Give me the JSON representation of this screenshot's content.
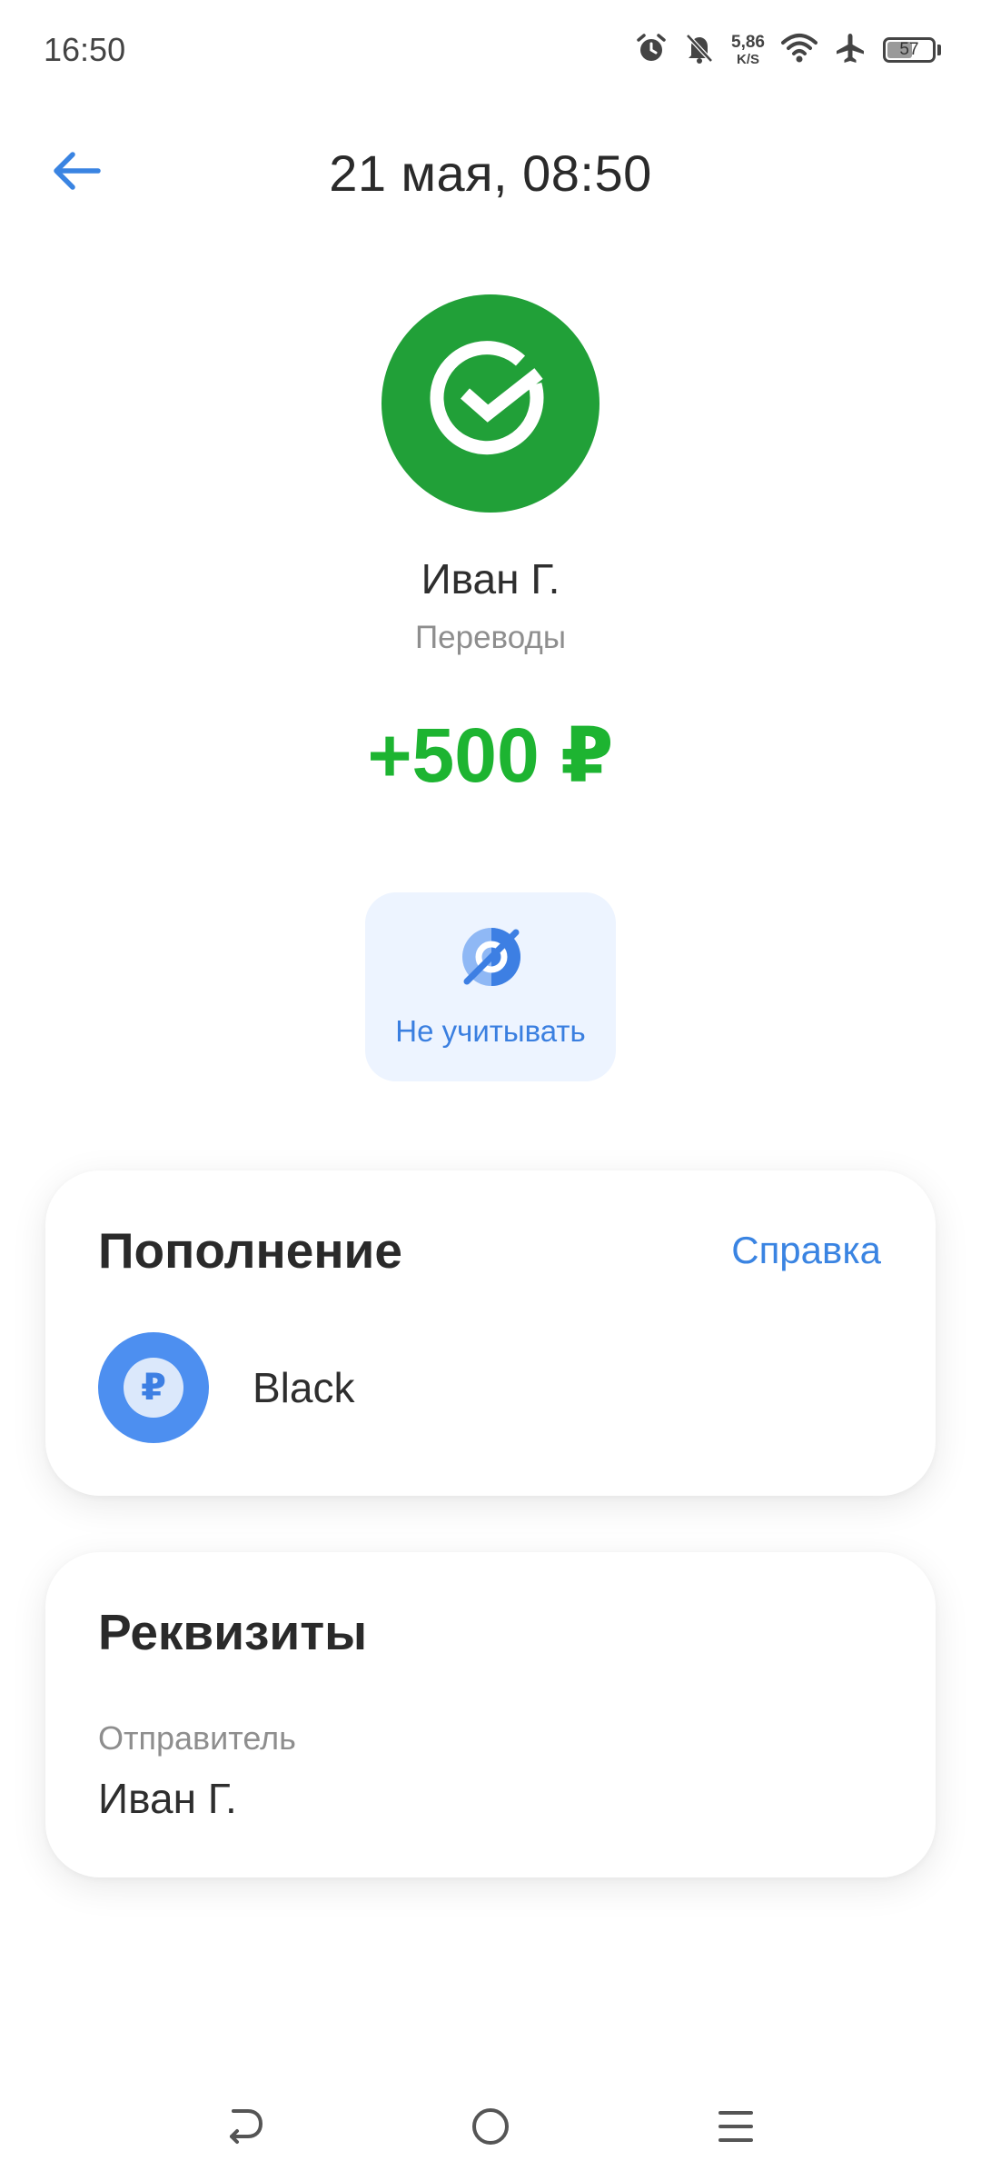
{
  "status_bar": {
    "time": "16:50",
    "net_speed_value": "5,86",
    "net_speed_unit": "K/S",
    "battery_level": "57",
    "battery_fraction": 0.57
  },
  "header": {
    "title": "21 мая, 08:50"
  },
  "transaction": {
    "name": "Иван Г.",
    "category": "Переводы",
    "amount": "+500 ₽"
  },
  "actions": {
    "ignore_label": "Не учитывать"
  },
  "deposit_card": {
    "title": "Пополнение",
    "help_label": "Справка",
    "account_symbol": "₽",
    "account_name": "Black"
  },
  "details_card": {
    "title": "Реквизиты",
    "sender_label": "Отправитель",
    "sender_value": "Иван Г."
  },
  "colors": {
    "brand_green": "#21a038",
    "amount_green": "#1db431",
    "accent_blue": "#3a84e2",
    "chip_background": "#edf4ff"
  }
}
